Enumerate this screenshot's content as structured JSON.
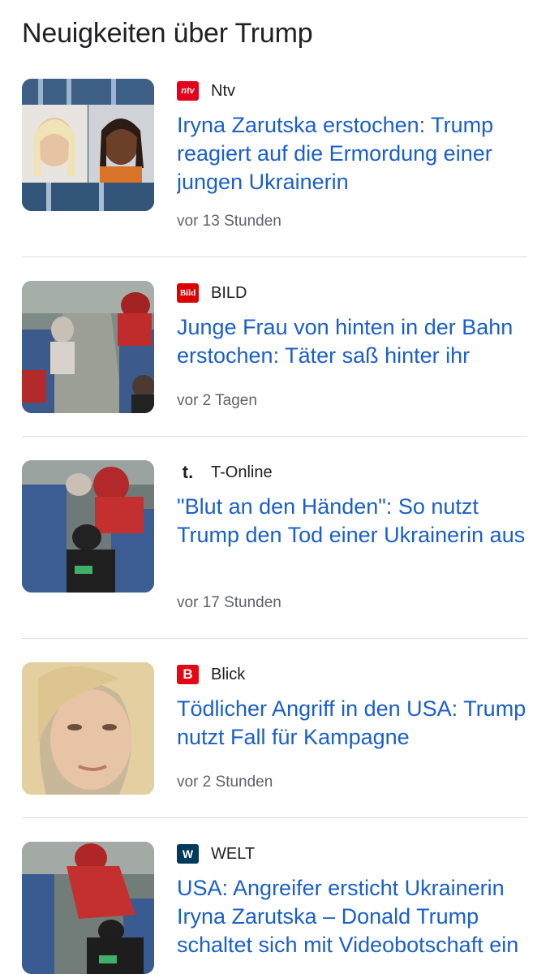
{
  "header": {
    "title": "Neuigkeiten über Trump"
  },
  "articles": [
    {
      "source": "Ntv",
      "logo_text": "ntv",
      "logo_color": "#e2001a",
      "headline": "Iryna Zarutska erstochen: Trump reagiert auf die Ermordung einer jungen Ukrainerin",
      "time": "vor 13 Stunden"
    },
    {
      "source": "BILD",
      "logo_text": "Bild",
      "logo_color": "#dd0000",
      "headline": "Junge Frau von hinten in der Bahn erstochen: Täter saß hinter ihr",
      "time": "vor 2 Tagen"
    },
    {
      "source": "T-Online",
      "logo_text": "t.",
      "logo_color": "#e20074",
      "headline": "\"Blut an den Händen\": So nutzt Trump den Tod einer Ukrainerin aus",
      "time": "vor 17 Stunden"
    },
    {
      "source": "Blick",
      "logo_text": "B",
      "logo_color": "#e30613",
      "headline": "Tödlicher Angriff in den USA: Trump nutzt Fall für Kampagne",
      "time": "vor 2 Stunden"
    },
    {
      "source": "WELT",
      "logo_text": "W",
      "logo_color": "#003a5d",
      "headline": "USA: Angreifer ersticht Ukrainerin Iryna Zarutska – Donald Trump schaltet sich mit Videobotschaft ein",
      "time": ""
    }
  ],
  "colors": {
    "link": "#1a5fcc",
    "divider": "#dadce0",
    "meta": "#5f6368"
  }
}
